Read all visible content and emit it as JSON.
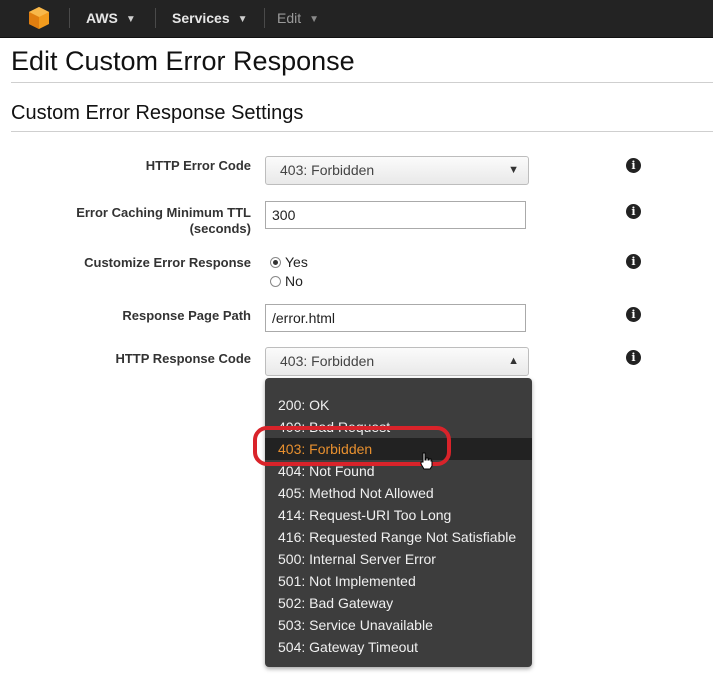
{
  "nav": {
    "aws_label": "AWS",
    "services_label": "Services",
    "edit_label": "Edit"
  },
  "page": {
    "title": "Edit Custom Error Response",
    "section_title": "Custom Error Response Settings"
  },
  "form": {
    "http_error_code": {
      "label": "HTTP Error Code",
      "value": "403: Forbidden"
    },
    "ttl": {
      "label_line1": "Error Caching Minimum TTL",
      "label_line2": "(seconds)",
      "value": "300"
    },
    "customize": {
      "label": "Customize Error Response",
      "options": [
        "Yes",
        "No"
      ],
      "selected": "Yes"
    },
    "page_path": {
      "label": "Response Page Path",
      "value": "/error.html"
    },
    "http_response_code": {
      "label": "HTTP Response Code",
      "value": "403: Forbidden"
    }
  },
  "dropdown": {
    "selected": "403: Forbidden",
    "options": [
      "200: OK",
      "400: Bad Request",
      "403: Forbidden",
      "404: Not Found",
      "405: Method Not Allowed",
      "414: Request-URI Too Long",
      "416: Requested Range Not Satisfiable",
      "500: Internal Server Error",
      "501: Not Implemented",
      "502: Bad Gateway",
      "503: Service Unavailable",
      "504: Gateway Timeout"
    ]
  },
  "colors": {
    "nav_bg": "#232323",
    "dropdown_bg": "#3d3d3d",
    "selected_text": "#e8902f",
    "highlight_ring": "#d9232a",
    "aws_logo": "#f29b1d"
  },
  "icons": {
    "logo": "aws-cube-logo",
    "info": "info-circle-icon",
    "chevron": "chevron-down-icon"
  }
}
